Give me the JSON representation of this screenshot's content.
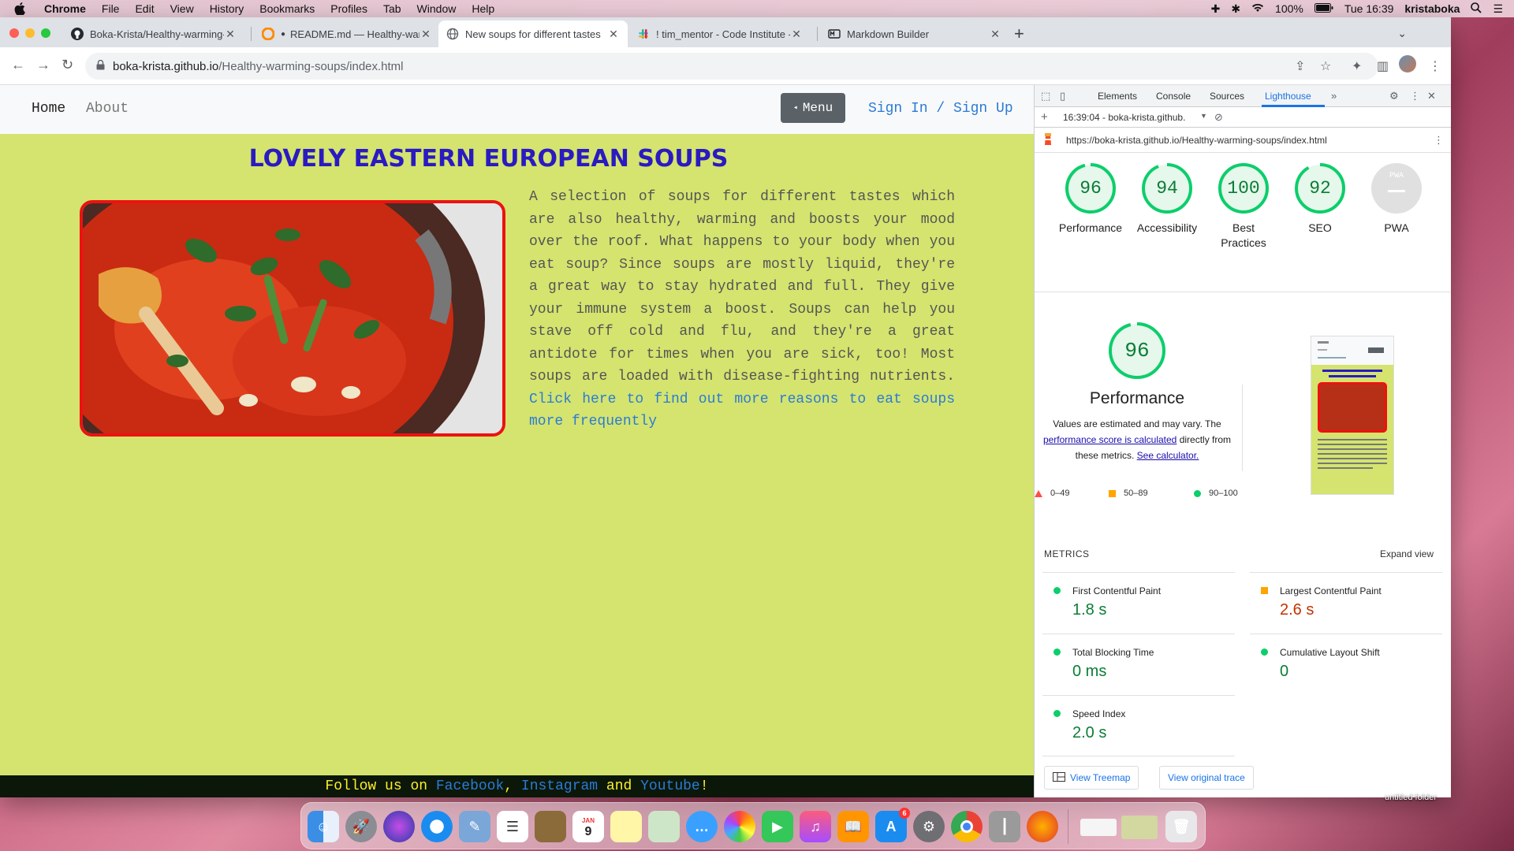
{
  "menubar": {
    "app": "Chrome",
    "items": [
      "File",
      "Edit",
      "View",
      "History",
      "Bookmarks",
      "Profiles",
      "Tab",
      "Window",
      "Help"
    ],
    "battery": "100%",
    "clock": "Tue 16:39",
    "user": "kristaboka"
  },
  "tabs": [
    {
      "title": "Boka-Krista/Healthy-warming-"
    },
    {
      "title": "README.md — Healthy-war"
    },
    {
      "title": "New soups for different tastes"
    },
    {
      "title": "! tim_mentor - Code Institute -"
    },
    {
      "title": "Markdown Builder"
    }
  ],
  "address": {
    "host": "boka-krista.github.io",
    "path": "/Healthy-warming-soups/index.html"
  },
  "site": {
    "nav_home": "Home",
    "nav_about": "About",
    "menu_button": "Menu",
    "sign_in": "Sign In / Sign Up",
    "headline": "LOVELY EASTERN EUROPEAN SOUPS",
    "description": "A selection of soups for different tastes which are also healthy, warming and boosts your mood over the roof. What happens to your body when you eat soup? Since soups are mostly liquid, they're a great way to stay hydrated and full. They give your immune system a boost. Soups can help you stave off cold and flu, and they're a great antidote for times when you are sick, too! Most soups are loaded with disease-fighting nutrients.",
    "description_link": "Click here to find out more reasons to eat soups more frequently",
    "footer_prefix": "Follow us on ",
    "footer_facebook": "Facebook",
    "footer_sep1": ", ",
    "footer_instagram": "Instagram",
    "footer_and": " and ",
    "footer_youtube": "Youtube",
    "footer_suffix": "!"
  },
  "devtools": {
    "tabs": [
      "Elements",
      "Console",
      "Sources",
      "Lighthouse"
    ],
    "report_time": "16:39:04 - boka-krista.github.",
    "report_url": "https://boka-krista.github.io/Healthy-warming-soups/index.html",
    "scores": [
      {
        "label": "Performance",
        "value": "96"
      },
      {
        "label": "Accessibility",
        "value": "94"
      },
      {
        "label": "Best Practices",
        "value": "100"
      },
      {
        "label": "SEO",
        "value": "92"
      },
      {
        "label": "PWA",
        "value": "PWA"
      }
    ],
    "perf_big": "96",
    "perf_title": "Performance",
    "perf_note_1": "Values are estimated and may vary. The ",
    "perf_note_link1": "performance score is calculated",
    "perf_note_2": " directly from these metrics. ",
    "perf_note_link2": "See calculator.",
    "legend": [
      "0–49",
      "50–89",
      "90–100"
    ],
    "metrics_heading": "METRICS",
    "expand_view": "Expand view",
    "metrics": [
      {
        "name": "First Contentful Paint",
        "value": "1.8 s",
        "status": "good"
      },
      {
        "name": "Largest Contentful Paint",
        "value": "2.6 s",
        "status": "average"
      },
      {
        "name": "Total Blocking Time",
        "value": "0 ms",
        "status": "good"
      },
      {
        "name": "Cumulative Layout Shift",
        "value": "0",
        "status": "good"
      },
      {
        "name": "Speed Index",
        "value": "2.0 s",
        "status": "good"
      }
    ],
    "view_treemap": "View Treemap",
    "view_trace": "View original trace"
  },
  "desktop": {
    "folder_label": "untitled folder",
    "calendar_day": "9",
    "calendar_month": "JAN",
    "appstore_badge": "6"
  },
  "colors": {
    "page_bg": "#d4e46e",
    "headline": "#2a1ac2",
    "link": "#2b7bd6",
    "good": "#0cce6b",
    "average": "#ffa400",
    "poor": "#ff4e42"
  }
}
